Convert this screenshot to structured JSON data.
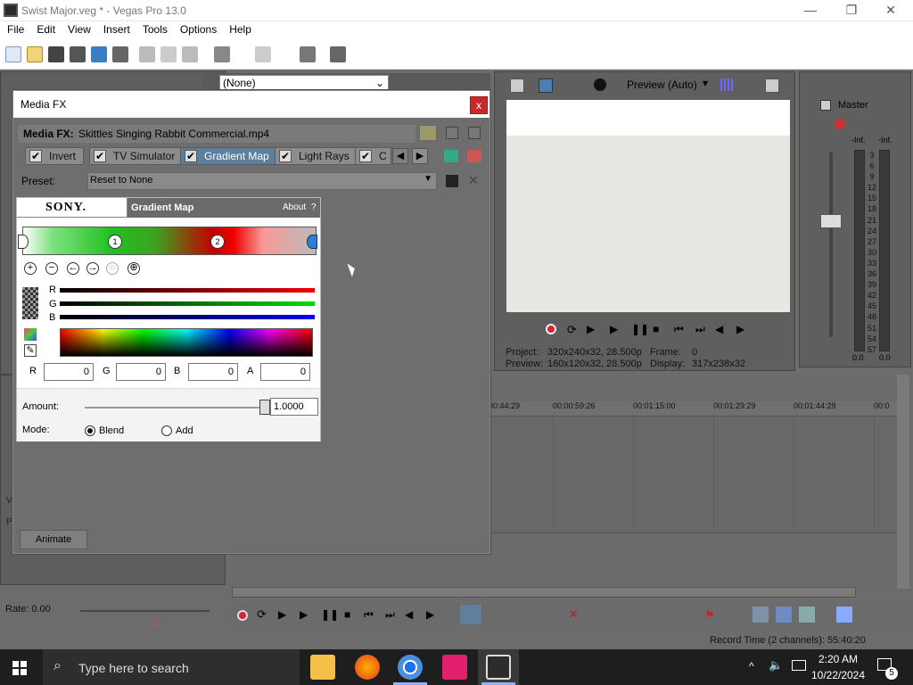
{
  "window": {
    "title": "Swist Major.veg * - Vegas Pro 13.0",
    "minimize": "—",
    "maximize": "❐",
    "close": "✕"
  },
  "menu": [
    "File",
    "Edit",
    "View",
    "Insert",
    "Tools",
    "Options",
    "Help"
  ],
  "fx_dropdown": {
    "value": "(None)"
  },
  "preview": {
    "mode_label": "Preview (Auto)",
    "project_label": "Project:",
    "project_value": "320x240x32, 28.500p",
    "frame_label": "Frame:",
    "frame_value": "0",
    "preview_label": "Preview:",
    "preview_value": "160x120x32, 28.500p",
    "display_label": "Display:",
    "display_value": "317x238x32"
  },
  "master": {
    "title": "Master",
    "left_peak": "-Inf.",
    "right_peak": "-Inf.",
    "scale": [
      "3",
      "6",
      "9",
      "12",
      "15",
      "18",
      "21",
      "24",
      "27",
      "30",
      "33",
      "36",
      "39",
      "42",
      "45",
      "48",
      "51",
      "54",
      "57"
    ],
    "left_value": "0.0",
    "right_value": "0.0"
  },
  "timeline": {
    "ruler": [
      "00:44:29",
      "00:00:59:26",
      "00:01:15:00",
      "00:01:29:29",
      "00:01:44:29",
      "00:0"
    ]
  },
  "rate": {
    "label": "Rate: 0.00"
  },
  "status": {
    "record_time": "Record Time (2 channels): 55:40:20"
  },
  "left_fragments": {
    "v": "V",
    "p": "P"
  },
  "media_fx": {
    "title": "Media FX",
    "close": "x",
    "header_label": "Media FX:",
    "header_value": "Skittles Singing Rabbit Commercial.mp4",
    "chain": [
      {
        "label": "Invert",
        "active": false
      },
      {
        "label": "TV Simulator",
        "active": false
      },
      {
        "label": "Gradient Map",
        "active": true
      },
      {
        "label": "Light Rays",
        "active": false
      },
      {
        "label": "C",
        "active": false
      }
    ],
    "preset_label": "Preset:",
    "preset_value": "Reset to None",
    "plugin": {
      "brand": "SONY.",
      "name": "Gradient Map",
      "about": "About",
      "help": "?",
      "stops": [
        "1",
        "2"
      ],
      "channels": {
        "r": "R",
        "g": "G",
        "b": "B"
      },
      "rgba_labels": [
        "R",
        "G",
        "B",
        "A"
      ],
      "rgba_values": [
        "0",
        "0",
        "0",
        "0"
      ],
      "amount_label": "Amount:",
      "amount_value": "1.0000",
      "amount_fraction": 1.0,
      "mode_label": "Mode:",
      "mode_options": [
        "Blend",
        "Add"
      ],
      "mode_selected": "Blend"
    },
    "animate_button": "Animate"
  },
  "taskbar": {
    "search_placeholder": "Type here to search",
    "time": "2:20 AM",
    "date": "10/22/2024",
    "notifications": "5"
  }
}
